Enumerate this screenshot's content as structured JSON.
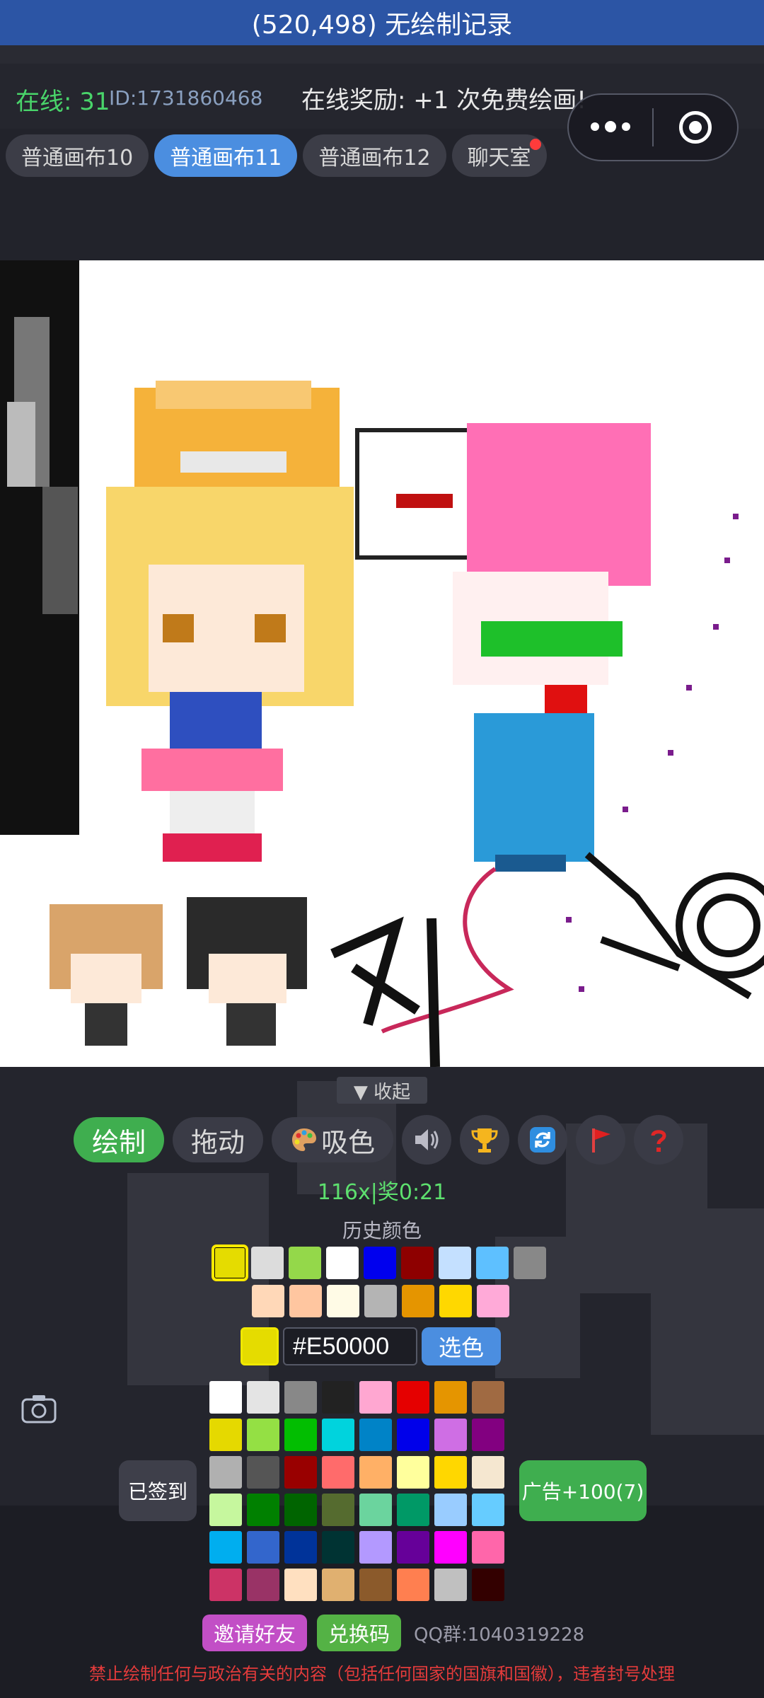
{
  "topbar": {
    "title": "(520,498) 无绘制记录"
  },
  "status": {
    "online_label": "在线: 31",
    "id_label": "ID:1731860468",
    "reward": "在线奖励: +1 次免费绘画!"
  },
  "tabs": [
    {
      "label": "普通画布10",
      "active": false
    },
    {
      "label": "普通画布11",
      "active": true
    },
    {
      "label": "普通画布12",
      "active": false
    },
    {
      "label": "聊天室",
      "active": false,
      "badge": true
    }
  ],
  "panel": {
    "collapse_label": "▼ 收起",
    "tools": {
      "draw": "绘制",
      "drag": "拖动",
      "eyedrop": "吸色"
    },
    "icons": [
      "speaker-icon",
      "trophy-icon",
      "refresh-icon",
      "flag-icon",
      "help-icon"
    ],
    "counter": "116x|奖0:21",
    "history_label": "历史颜色",
    "history_row1": [
      "#e5dc00",
      "#dcdcdc",
      "#94d84a",
      "#ffffff",
      "#0000ee",
      "#8e0000",
      "#c4e0ff",
      "#5ec0ff",
      "#888888"
    ],
    "history_row2": [
      "#ffd8b8",
      "#ffc6a0",
      "#fffbe6",
      "#b4b4b4",
      "#e59500",
      "#ffd800",
      "#ffaad8"
    ],
    "hex_value": "#E50000",
    "pick_label": "选色",
    "palette": [
      "#ffffff",
      "#e4e4e4",
      "#888888",
      "#222222",
      "#ffa7d1",
      "#e50000",
      "#e59500",
      "#a06a42",
      "#e5d900",
      "#94e044",
      "#02be01",
      "#00d3dd",
      "#0083c7",
      "#0000ea",
      "#cf6ee4",
      "#820080",
      "#b0b0b0",
      "#555555",
      "#990000",
      "#ff6b6b",
      "#ffb066",
      "#ffff9c",
      "#ffd700",
      "#f5e7d0",
      "#c6f79e",
      "#008000",
      "#006400",
      "#556b2f",
      "#6bd49e",
      "#009966",
      "#99ccff",
      "#66ccff",
      "#00aeef",
      "#3366cc",
      "#003399",
      "#003333",
      "#b399ff",
      "#660099",
      "#ff00ff",
      "#ff66aa",
      "#cc3366",
      "#993366",
      "#ffe0c0",
      "#e0b070",
      "#8b5a2b",
      "#ff7f50",
      "#c0c0c0",
      "#330000"
    ],
    "checkin_label": "已签到",
    "ad_label": "广告+100(7)",
    "invite_label": "邀请好友",
    "redeem_label": "兑换码",
    "qq_label": "QQ群:1040319228",
    "warning": "禁止绘制任何与政治有关的内容（包括任何国家的国旗和国徽），违者封号处理"
  }
}
